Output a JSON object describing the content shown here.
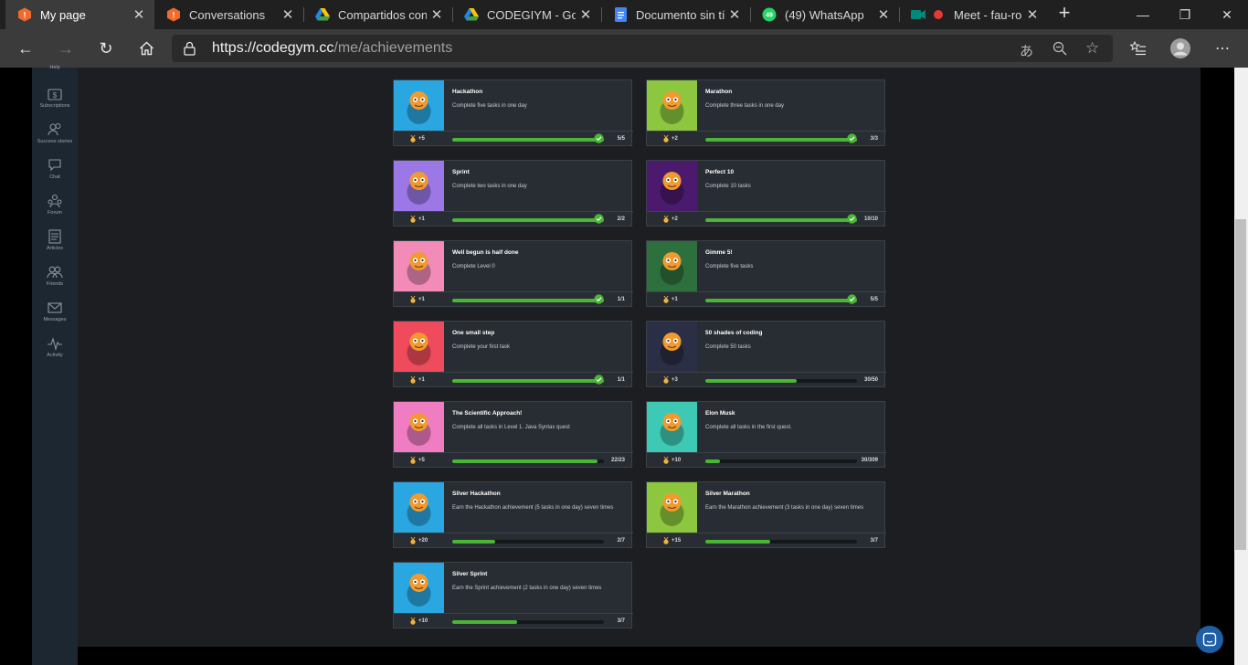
{
  "browser": {
    "tabs": [
      {
        "title": "My page",
        "icon": "codegym-icon"
      },
      {
        "title": "Conversations",
        "icon": "codegym-icon"
      },
      {
        "title": "Compartidos conm",
        "icon": "google-drive-icon"
      },
      {
        "title": "CODEGIYM - Goo",
        "icon": "google-drive-icon"
      },
      {
        "title": "Documento sin tít",
        "icon": "google-docs-icon"
      },
      {
        "title": "(49) WhatsApp",
        "icon": "whatsapp-icon"
      },
      {
        "title": "Meet - fau-ro",
        "icon": "google-meet-icon"
      }
    ],
    "url_host": "https://codegym.cc",
    "url_path": "/me/achievements"
  },
  "sidebar": {
    "items": [
      {
        "label": "Help",
        "icon": "help-icon"
      },
      {
        "label": "Subscriptions",
        "icon": "dollar-icon"
      },
      {
        "label": "Success stories",
        "icon": "users-icon"
      },
      {
        "label": "Chat",
        "icon": "chat-icon"
      },
      {
        "label": "Forum",
        "icon": "forum-icon"
      },
      {
        "label": "Articles",
        "icon": "articles-icon"
      },
      {
        "label": "Friends",
        "icon": "friends-icon"
      },
      {
        "label": "Messages",
        "icon": "envelope-icon"
      },
      {
        "label": "Activity",
        "icon": "pulse-icon"
      }
    ]
  },
  "achievements": [
    {
      "title": "Hackathon",
      "desc": "Complete five tasks in one day",
      "reward": "+5",
      "count": "5/5",
      "progress": 1.0,
      "done": true,
      "color": "#2aa7e0"
    },
    {
      "title": "Marathon",
      "desc": "Complete three tasks in one day",
      "reward": "+2",
      "count": "3/3",
      "progress": 1.0,
      "done": true,
      "color": "#8dc63f"
    },
    {
      "title": "Sprint",
      "desc": "Complete two tasks in one day",
      "reward": "+1",
      "count": "2/2",
      "progress": 1.0,
      "done": true,
      "color": "#9b78e6"
    },
    {
      "title": "Perfect 10",
      "desc": "Complete 10 tasks",
      "reward": "+2",
      "count": "10/10",
      "progress": 1.0,
      "done": true,
      "color": "#4b1a6e"
    },
    {
      "title": "Well begun is half done",
      "desc": "Complete Level 0",
      "reward": "+1",
      "count": "1/1",
      "progress": 1.0,
      "done": true,
      "color": "#f28bb8"
    },
    {
      "title": "Gimme 5!",
      "desc": "Complete five tasks",
      "reward": "+1",
      "count": "5/5",
      "progress": 1.0,
      "done": true,
      "color": "#2e6f3e"
    },
    {
      "title": "One small step",
      "desc": "Complete your first task",
      "reward": "+1",
      "count": "1/1",
      "progress": 1.0,
      "done": true,
      "color": "#ef4b5c"
    },
    {
      "title": "50 shades of coding",
      "desc": "Complete 50 tasks",
      "reward": "+3",
      "count": "30/50",
      "progress": 0.6,
      "done": false,
      "color": "#2b2f45"
    },
    {
      "title": "The Scientific Approach!",
      "desc": "Complete all tasks in Level 1. Java Syntax quest",
      "reward": "+5",
      "count": "22/23",
      "progress": 0.957,
      "done": false,
      "color": "#f07cc2"
    },
    {
      "title": "Elon Musk",
      "desc": "Complete all tasks in the first quest.",
      "reward": "+10",
      "count": "30/309",
      "progress": 0.097,
      "done": false,
      "color": "#3ec9b5"
    },
    {
      "title": "Silver Hackathon",
      "desc": "Earn the Hackathon achievement (5 tasks in one day) seven times",
      "reward": "+20",
      "count": "2/7",
      "progress": 0.286,
      "done": false,
      "color": "#2aa7e0"
    },
    {
      "title": "Silver Marathon",
      "desc": "Earn the Marathon achievement (3 tasks in one day) seven times",
      "reward": "+15",
      "count": "3/7",
      "progress": 0.429,
      "done": false,
      "color": "#8dc63f"
    },
    {
      "title": "Silver Sprint",
      "desc": "Earn the Sprint achievement (2 tasks in one day) seven times",
      "reward": "+10",
      "count": "3/7",
      "progress": 0.429,
      "done": false,
      "color": "#2aa7e0"
    }
  ]
}
